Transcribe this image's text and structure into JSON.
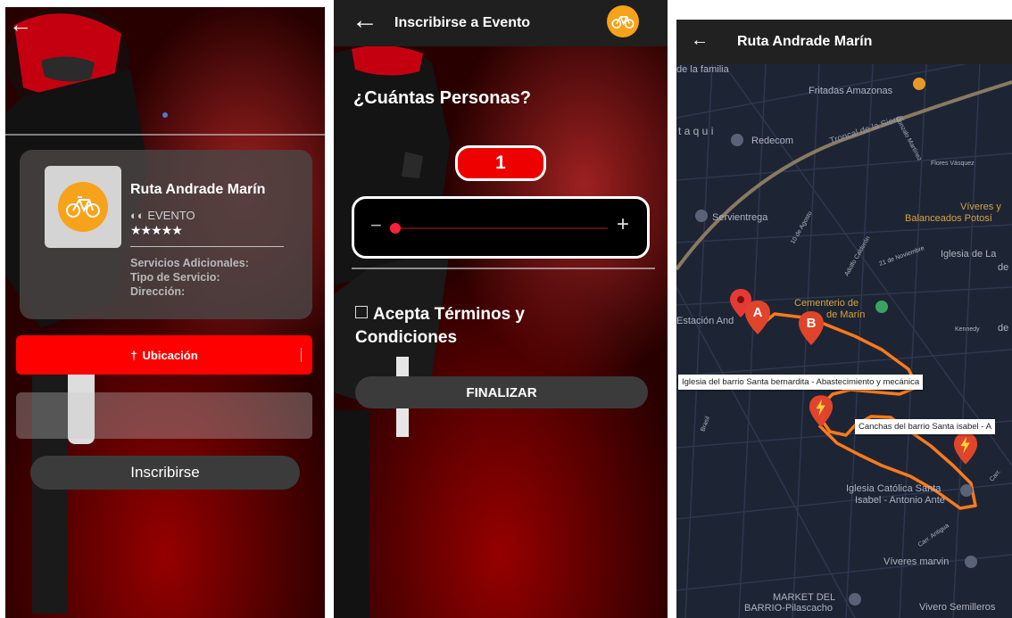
{
  "panel1": {
    "event": {
      "title": "Ruta Andrade Marín",
      "type_label": "EVENTO",
      "stars": "★★★★★",
      "rating": 5,
      "services_label": "Servicios Adicionales:",
      "service_type_label": "Tipo de Servicio:",
      "address_label": "Dirección:"
    },
    "location_button": "Ubicación",
    "register_button": "Inscribirse"
  },
  "panel2": {
    "title": "Inscribirse a Evento",
    "question": "¿Cuántas Personas?",
    "count": "1",
    "minus": "−",
    "plus": "+",
    "slider_level": 0.0,
    "terms": "Acepta Términos y Condiciones",
    "finish_button": "FINALIZAR"
  },
  "panel3": {
    "title": "Ruta Andrade Marín",
    "markers": {
      "a": "A",
      "b": "B"
    },
    "tooltips": {
      "first": "Iglesia del barrio Santa bernardita - Abastecimiento y mecánica",
      "second": "Canchas del barrio Santa isabel - A"
    },
    "places": {
      "familia": "de la familia",
      "fritadas": "Fritadas Amazonas",
      "taqui": "t a q u i",
      "redecom": "Redecom",
      "troncal": "Troncal de la Sierra",
      "gonzalo": "Gonzalo Martínez",
      "flores": "Flores Vásquez",
      "servientrega": "Servientrega",
      "viveres1": "Víveres y",
      "balanceados": "Balanceados Potosí",
      "iglesia_la": "Iglesia de La",
      "de": "de",
      "noviembre": "21 de Noviembre",
      "agosto": "10 de Agosto",
      "almirante": "Adolfo Calderón",
      "cementerio1": "Cementerio de",
      "cementerio2": "de Marín",
      "estacion": "Estación And",
      "kennedy": "Kennedy",
      "iglesia_cat1": "Iglesia Católica Santa",
      "iglesia_cat2": "Isabel - Antonio Ante",
      "viveres_marvin": "Víveres marvin",
      "market1": "MARKET DEL",
      "market2": "BARRIO-Pilascacho",
      "vivero": "Vivero Semilleros",
      "carr_antigua": "Carr. Antigua",
      "brasil": "Brasil",
      "carr": "Carr."
    },
    "route_color": "#ff7a1a",
    "marker_color": "#e0442b"
  },
  "colors": {
    "accent_red": "#ff0000",
    "orange": "#f7a21b",
    "dark_button": "#3c3b3b"
  }
}
